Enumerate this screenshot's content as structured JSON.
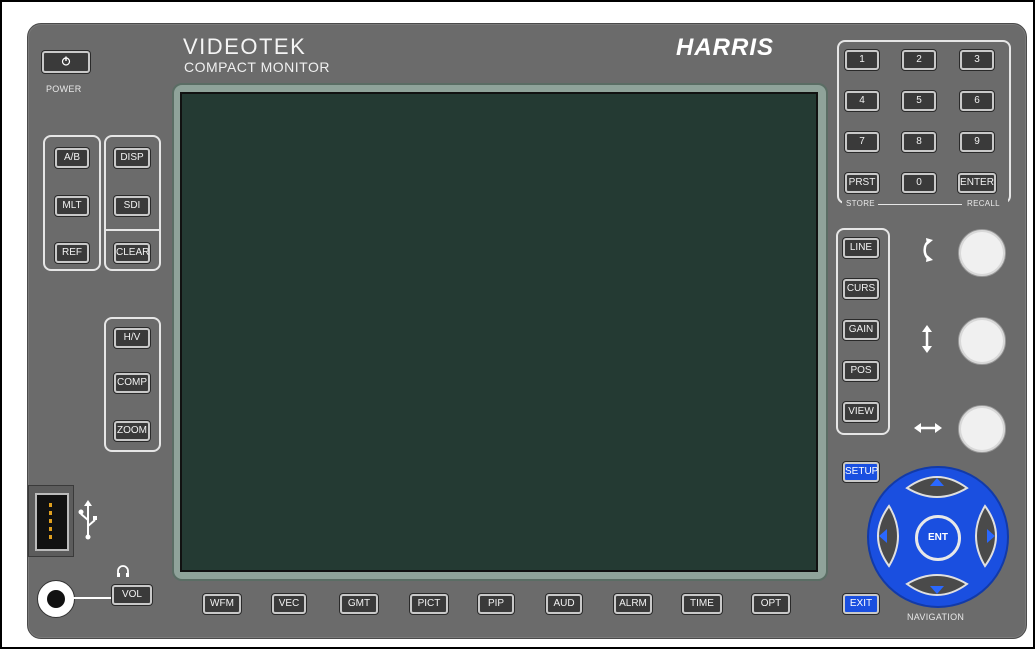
{
  "branding": {
    "title": "VIDEOTEK",
    "subtitle": "COMPACT MONITOR",
    "logo": "HARRIS"
  },
  "power": {
    "icon": "power-icon",
    "label": "POWER"
  },
  "left_group_a": [
    "A/B",
    "MLT",
    "REF"
  ],
  "left_group_b": [
    "DISP",
    "SDI",
    "CLEAR"
  ],
  "left_group_c": [
    "H/V",
    "COMP",
    "ZOOM"
  ],
  "usb": {
    "icon": "usb-icon"
  },
  "audio": {
    "headphone_icon": "headphone-icon",
    "vol_label": "VOL"
  },
  "bottom_buttons": [
    "WFM",
    "VEC",
    "GMT",
    "PICT",
    "PIP",
    "AUD",
    "ALRM",
    "TIME",
    "OPT"
  ],
  "keypad": {
    "keys": [
      "1",
      "2",
      "3",
      "4",
      "5",
      "6",
      "7",
      "8",
      "9",
      "PRST",
      "0",
      "ENTER"
    ],
    "store_label": "STORE",
    "recall_label": "RECALL"
  },
  "right_group": [
    "LINE",
    "CURS",
    "GAIN",
    "POS",
    "VIEW"
  ],
  "knobs": [
    {
      "icon": "rotate-icon"
    },
    {
      "icon": "vertical-arrows-icon"
    },
    {
      "icon": "horizontal-arrows-icon"
    }
  ],
  "setup_label": "SETUP",
  "exit_label": "EXIT",
  "navigation": {
    "label": "NAVIGATION",
    "center_label": "ENT"
  },
  "colors": {
    "panel": "#6b6b6b",
    "screen": "#243a33",
    "accent_blue": "#1a4fe0"
  }
}
